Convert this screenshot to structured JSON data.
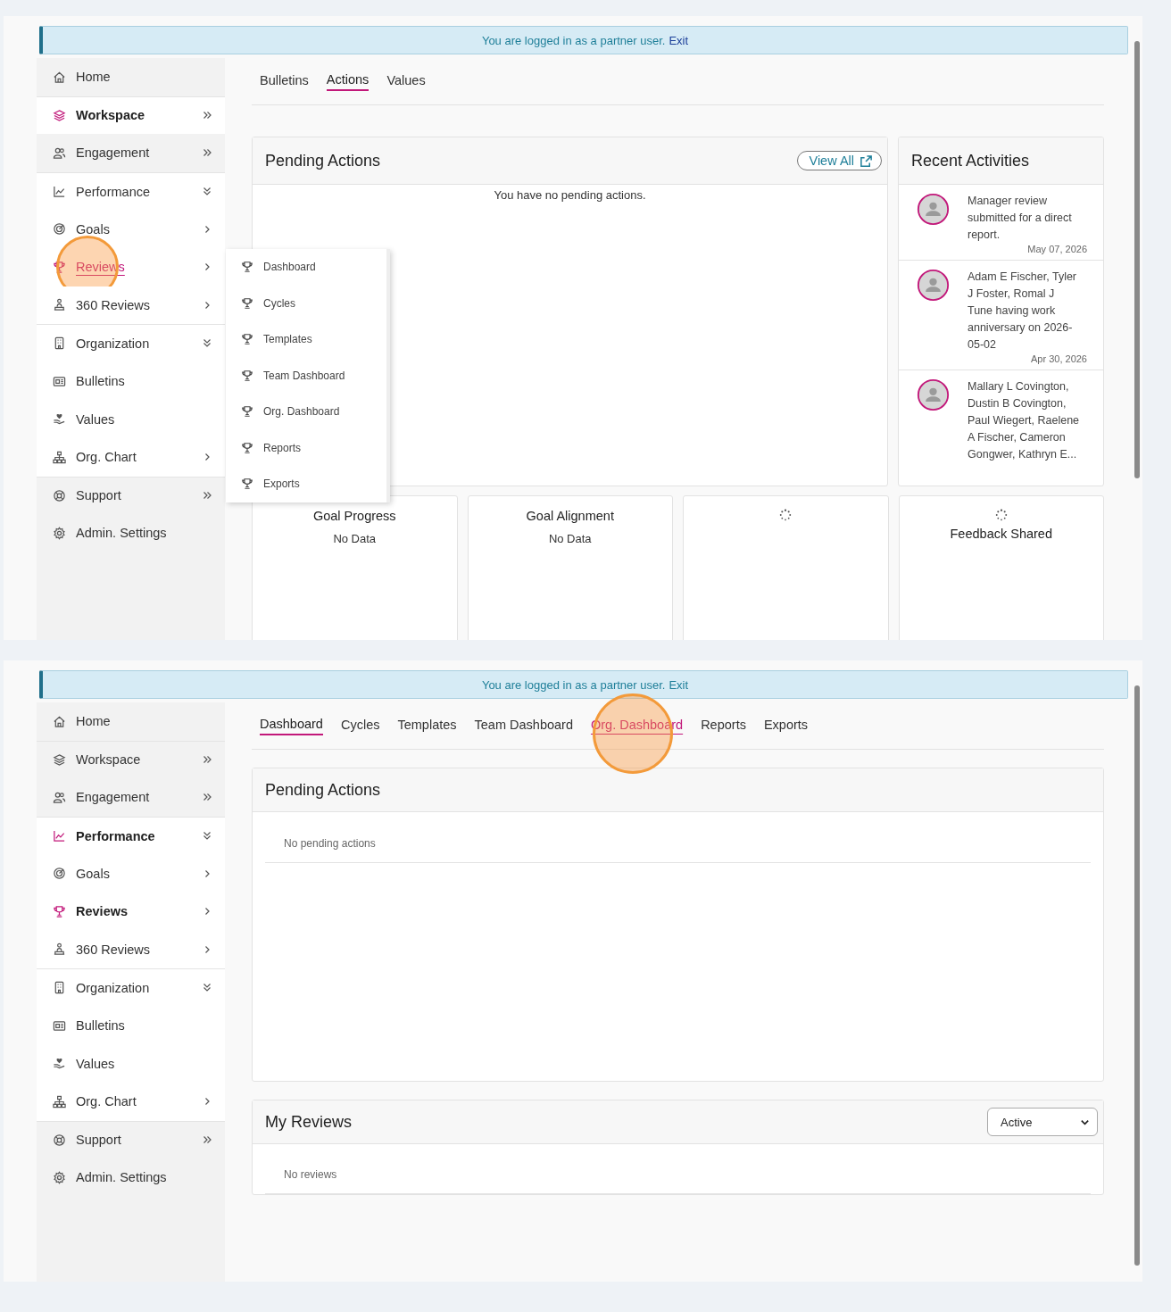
{
  "panels": [
    {
      "banner": {
        "text": "You are logged in as a partner user.",
        "link": "Exit"
      },
      "sidebar": [
        {
          "label": "Home",
          "selected": false,
          "open": false,
          "hovered": false,
          "clicked": false
        },
        {
          "label": "Workspace",
          "selected": true,
          "open": true,
          "hovered": false,
          "clicked": false
        },
        {
          "label": "Engagement",
          "selected": false,
          "open": false,
          "hovered": false,
          "clicked": false
        },
        {
          "label": "Performance",
          "selected": false,
          "open": true,
          "hovered": false,
          "clicked": false
        },
        {
          "label": "Goals",
          "selected": false,
          "open": true,
          "hovered": false,
          "clicked": false
        },
        {
          "label": "Reviews",
          "selected": false,
          "open": true,
          "hovered": true,
          "clicked": true
        },
        {
          "label": "360 Reviews",
          "selected": false,
          "open": true,
          "hovered": false,
          "clicked": false
        },
        {
          "label": "Organization",
          "selected": false,
          "open": true,
          "hovered": false,
          "clicked": false
        },
        {
          "label": "Bulletins",
          "selected": false,
          "open": true,
          "hovered": false,
          "clicked": false
        },
        {
          "label": "Values",
          "selected": false,
          "open": true,
          "hovered": false,
          "clicked": false
        },
        {
          "label": "Org. Chart",
          "selected": false,
          "open": true,
          "hovered": false,
          "clicked": false
        },
        {
          "label": "Support",
          "selected": false,
          "open": false,
          "hovered": false,
          "clicked": false
        },
        {
          "label": "Admin. Settings",
          "selected": false,
          "open": false,
          "hovered": false,
          "clicked": false
        }
      ],
      "flyout": [
        "Dashboard",
        "Cycles",
        "Templates",
        "Team Dashboard",
        "Org. Dashboard",
        "Reports",
        "Exports"
      ],
      "tabs": [
        {
          "label": "Bulletins",
          "selected": false,
          "hovered": false,
          "clicked": false
        },
        {
          "label": "Actions",
          "selected": true,
          "hovered": false,
          "clicked": false
        },
        {
          "label": "Values",
          "selected": false,
          "hovered": false,
          "clicked": false
        }
      ],
      "pending": {
        "title": "Pending Actions",
        "button": "View All",
        "message": "You have no pending actions."
      },
      "recent": {
        "title": "Recent Activities",
        "items": [
          {
            "text": "Manager review submitted for a direct report.",
            "date": "May 07, 2026"
          },
          {
            "text": "Adam E Fischer, Tyler J Foster, Romal J Tune having work anniversary on 2026-05-02",
            "date": "Apr 30, 2026"
          },
          {
            "text": "Mallary L Covington, Dustin B Covington, Paul Wiegert, Raelene A Fischer, Cameron Gongwer, Kathryn E..."
          }
        ]
      },
      "cards": [
        {
          "title": "Goal Progress",
          "value": "No Data",
          "loading": false
        },
        {
          "title": "Goal Alignment",
          "value": "No Data",
          "loading": false
        },
        {
          "loading": true
        },
        {
          "title": "Feedback Shared",
          "loading": true
        }
      ]
    },
    {
      "banner": {
        "text": "You are logged in as a partner user.",
        "link": "Exit"
      },
      "sidebar": [
        {
          "label": "Home",
          "selected": false,
          "open": false,
          "hovered": false,
          "clicked": false
        },
        {
          "label": "Workspace",
          "selected": false,
          "open": false,
          "hovered": false,
          "clicked": false
        },
        {
          "label": "Engagement",
          "selected": false,
          "open": false,
          "hovered": false,
          "clicked": false
        },
        {
          "label": "Performance",
          "selected": true,
          "open": true,
          "hovered": false,
          "clicked": false
        },
        {
          "label": "Goals",
          "selected": false,
          "open": true,
          "hovered": false,
          "clicked": false
        },
        {
          "label": "Reviews",
          "selected": true,
          "open": true,
          "hovered": false,
          "clicked": false
        },
        {
          "label": "360 Reviews",
          "selected": false,
          "open": true,
          "hovered": false,
          "clicked": false
        },
        {
          "label": "Organization",
          "selected": false,
          "open": true,
          "hovered": false,
          "clicked": false
        },
        {
          "label": "Bulletins",
          "selected": false,
          "open": true,
          "hovered": false,
          "clicked": false
        },
        {
          "label": "Values",
          "selected": false,
          "open": true,
          "hovered": false,
          "clicked": false
        },
        {
          "label": "Org. Chart",
          "selected": false,
          "open": true,
          "hovered": false,
          "clicked": false
        },
        {
          "label": "Support",
          "selected": false,
          "open": false,
          "hovered": false,
          "clicked": false
        },
        {
          "label": "Admin. Settings",
          "selected": false,
          "open": false,
          "hovered": false,
          "clicked": false
        }
      ],
      "tabs": [
        {
          "label": "Dashboard",
          "selected": true,
          "hovered": false,
          "clicked": false
        },
        {
          "label": "Cycles",
          "selected": false,
          "hovered": false,
          "clicked": false
        },
        {
          "label": "Templates",
          "selected": false,
          "hovered": false,
          "clicked": false
        },
        {
          "label": "Team Dashboard",
          "selected": false,
          "hovered": false,
          "clicked": false
        },
        {
          "label": "Org. Dashboard",
          "selected": false,
          "hovered": true,
          "clicked": true
        },
        {
          "label": "Reports",
          "selected": false,
          "hovered": false,
          "clicked": false
        },
        {
          "label": "Exports",
          "selected": false,
          "hovered": false,
          "clicked": false
        }
      ],
      "pending": {
        "title": "Pending Actions",
        "message": "No pending actions"
      },
      "my_reviews": {
        "title": "My Reviews",
        "filter": "Active",
        "message": "No reviews"
      }
    }
  ]
}
